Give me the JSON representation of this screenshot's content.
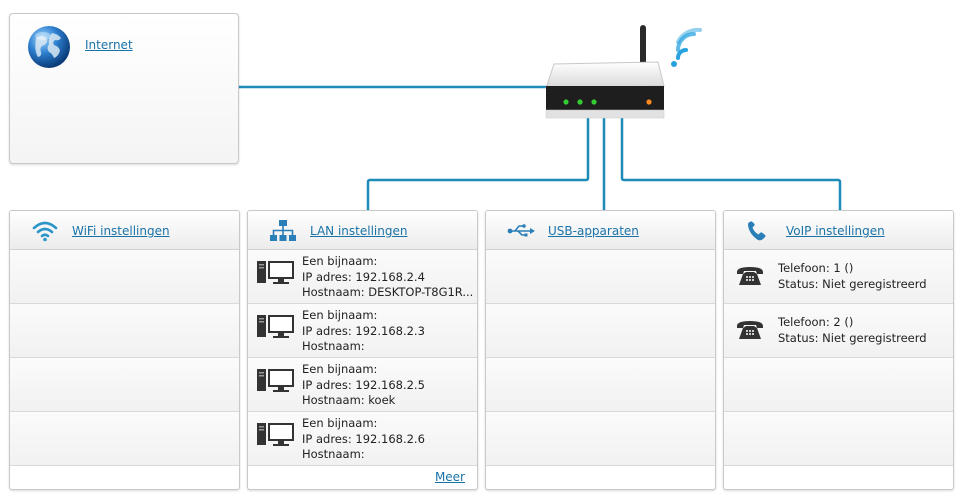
{
  "internet": {
    "label": "Internet",
    "icon": "globe-icon"
  },
  "router": {
    "icon": "router-icon",
    "signal_icon": "wifi-signal-icon"
  },
  "colors": {
    "line": "#1f8bb8",
    "link": "#1a73a8",
    "led_green": "#33cc33",
    "led_orange": "#ff8a1f"
  },
  "panels": {
    "wifi": {
      "title": "WiFi instellingen",
      "icon": "wifi-icon"
    },
    "lan": {
      "title": "LAN instellingen",
      "icon": "network-icon",
      "devices": [
        {
          "name": "Een bijnaam:",
          "ip": "IP adres: 192.168.2.4",
          "host": "Hostnaam: DESKTOP-T8G1R..."
        },
        {
          "name": "Een bijnaam:",
          "ip": "IP adres: 192.168.2.3",
          "host": "Hostnaam:"
        },
        {
          "name": "Een bijnaam:",
          "ip": "IP adres: 192.168.2.5",
          "host": "Hostnaam: koek"
        },
        {
          "name": "Een bijnaam:",
          "ip": "IP adres: 192.168.2.6",
          "host": "Hostnaam:"
        }
      ],
      "more_label": "Meer"
    },
    "usb": {
      "title": "USB-apparaten",
      "icon": "usb-icon"
    },
    "voip": {
      "title": "VoIP instellingen",
      "icon": "phone-icon",
      "phones": [
        {
          "line": "Telefoon: 1 ()",
          "status": "Status: Niet geregistreerd"
        },
        {
          "line": "Telefoon: 2 ()",
          "status": "Status: Niet geregistreerd"
        }
      ]
    }
  }
}
